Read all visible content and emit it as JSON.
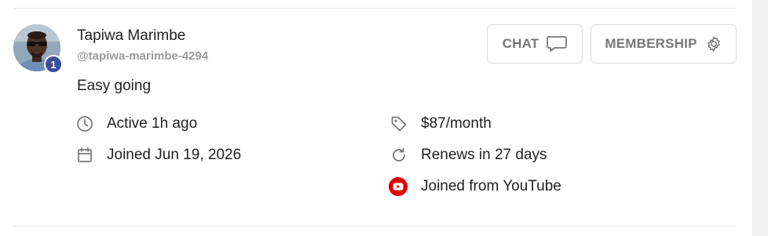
{
  "member": {
    "name": "Tapiwa Marimbe",
    "handle": "@tapiwa-marimbe-4294",
    "bio": "Easy going",
    "badge_count": "1"
  },
  "actions": {
    "chat_label": "CHAT",
    "membership_label": "MEMBERSHIP"
  },
  "details": {
    "active": "Active 1h ago",
    "joined": "Joined Jun 19, 2026",
    "price": "$87/month",
    "renews": "Renews in 27 days",
    "source": "Joined from YouTube"
  },
  "icons": {
    "active": "clock-icon",
    "joined": "calendar-icon",
    "price": "price-tag-icon",
    "renews": "refresh-icon",
    "source": "youtube-icon",
    "chat": "chat-bubble-icon",
    "membership": "gear-icon"
  },
  "colors": {
    "badge": "#3c4f9c",
    "youtube": "#e60000",
    "muted_text": "#9a9a9a",
    "button_text": "#777777"
  }
}
